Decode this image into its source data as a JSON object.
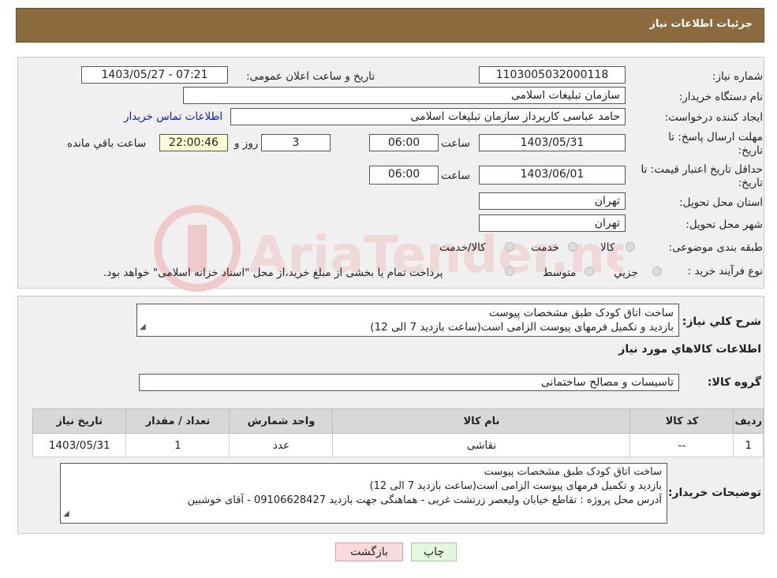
{
  "header": {
    "title": "جزئیات اطلاعات نیاز"
  },
  "form": {
    "need_number": {
      "label": "شماره نیاز:",
      "value": "1103005032000118"
    },
    "announce_datetime": {
      "label": "تاریخ و ساعت اعلان عمومی:",
      "value": "1403/05/27 - 07:21"
    },
    "buyer_org": {
      "label": "نام دستگاه خریدار:",
      "value": "سازمان تبلیغات اسلامی"
    },
    "requester": {
      "label": "ایجاد کننده درخواست:",
      "value": "حامد عباسی کارپرداز سازمان تبلیغات اسلامی",
      "contact_link": "اطلاعات تماس خریدار"
    },
    "reply_deadline": {
      "label_line1": "مهلت ارسال پاسخ: تا",
      "label_line2": "تاریخ:",
      "date": "1403/05/31",
      "time_label": "ساعت",
      "time": "06:00",
      "days": "3",
      "days_label": "روز و",
      "remaining": "22:00:46",
      "remaining_label": "ساعت باقي مانده"
    },
    "price_validity": {
      "label_line1": "حداقل تاریخ اعتبار قیمت: تا",
      "label_line2": "تاریخ:",
      "date": "1403/06/01",
      "time_label": "ساعت",
      "time": "06:00"
    },
    "delivery_province": {
      "label": "استان محل تحویل:",
      "value": "تهران"
    },
    "delivery_city": {
      "label": "شهر محل تحویل:",
      "value": "تهران"
    },
    "category": {
      "label": "طبقه بندی موضوعی:",
      "options": [
        "کالا",
        "خدمت",
        "کالا/خدمت"
      ]
    },
    "purchase_process": {
      "label": "نوع فرآیند خرید :",
      "options": [
        "جزيي",
        "متوسط"
      ],
      "note": "پرداخت تمام یا بخشی از مبلغ خرید،از محل \"اسناد خزانه اسلامی\" خواهد بود."
    }
  },
  "description": {
    "label": "شرح کلي نياز:",
    "lines": [
      "ساخت اتاق کودک طبق مشخصات پیوست",
      "بازدید و تکمیل فرمهای پیوست الزامی است(ساعت بازدید 7 الی 12)"
    ]
  },
  "goods_info": {
    "title": "اطلاعات کالاهاي مورد نياز"
  },
  "goods_group": {
    "label": "گروه کالا:",
    "value": "تاسیسات و مصالح ساختمانی"
  },
  "table": {
    "headers": [
      "رديف",
      "کد کالا",
      "نام کالا",
      "واحد شمارش",
      "تعداد / مقدار",
      "تاریخ نیاز"
    ],
    "rows": [
      [
        "1",
        "--",
        "نقاشی",
        "عدد",
        "1",
        "1403/05/31"
      ]
    ]
  },
  "buyer_notes": {
    "label": "توضیحات خریدار:",
    "lines": [
      "ساخت اتاق کودک طبق مشخصات پیوست",
      "بازدید و تکمیل فرمهای پیوست الزامی است(ساعت بازدید 7 الی 12)",
      "آدرس محل پروژه : تقاطع خیابان ولیعصر زرتشت غربی - هماهنگی جهت بازدید 09106628427 - آقای خوشبین"
    ]
  },
  "buttons": {
    "print": "چاپ",
    "back": "بازگشت"
  },
  "watermark": {
    "text": "AriaTender.neT"
  },
  "colors": {
    "header_bg": "#8b6b3e",
    "panel_bg": "#f0f0f0",
    "link": "#1515c8",
    "back_button_bg": "#f9d9d9",
    "print_button_bg": "#e6f7e0"
  }
}
